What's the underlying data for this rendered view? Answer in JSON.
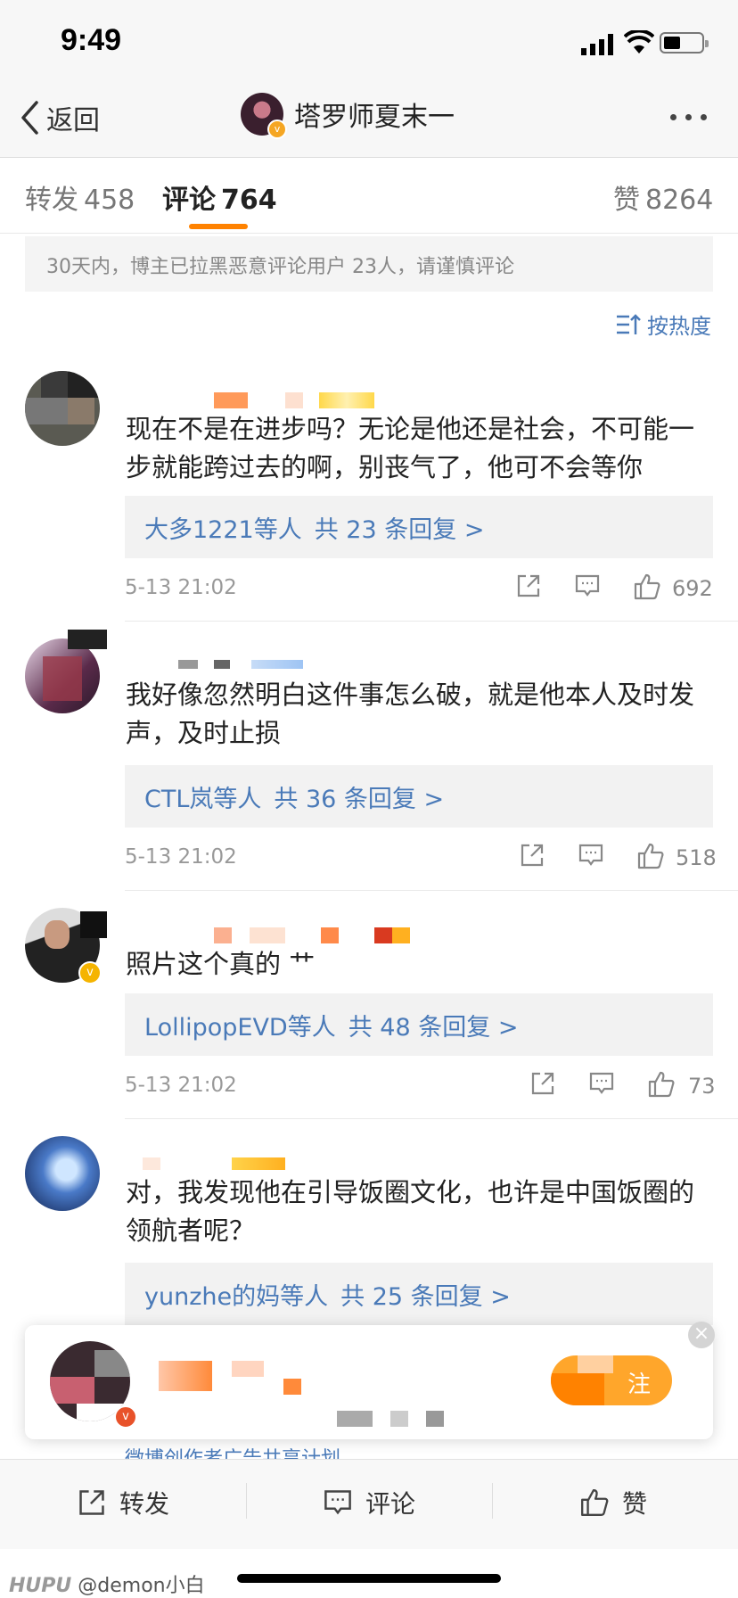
{
  "status_bar": {
    "time": "9:49"
  },
  "nav": {
    "back_label": "返回",
    "title": "塔罗师夏末一"
  },
  "tabs": {
    "repost_label": "转发",
    "repost_count": "458",
    "comment_label": "评论",
    "comment_count": "764",
    "like_label": "赞",
    "like_count": "8264"
  },
  "notice": "30天内，博主已拉黑恶意评论用户 23人，请谨慎评论",
  "sort_label": "按热度",
  "comments": [
    {
      "text": "现在不是在进步吗？无论是他还是社会，不可能一步就能跨过去的啊，别丧气了，他可不会等你",
      "reply_who": "大多1221等人",
      "reply_count": "共 23 条回复 >",
      "date": "5-13 21:02",
      "likes": "692"
    },
    {
      "text": "我好像忽然明白这件事怎么破，就是他本人及时发声，及时止损",
      "reply_who": "CTL岚等人",
      "reply_count": "共 36 条回复 >",
      "date": "5-13 21:02",
      "likes": "518"
    },
    {
      "text": "照片这个真的 艹",
      "reply_who": "LollipopEVD等人",
      "reply_count": "共 48 条回复 >",
      "date": "5-13 21:02",
      "likes": "73"
    },
    {
      "text": "对，我发现他在引导饭圈文化，也许是中国饭圈的领航者呢？",
      "reply_who": "yunzhe的妈等人",
      "reply_count": "共 25 条回复 >"
    }
  ],
  "ad": {
    "button_text": "注",
    "under_text": "微博创作者广告共享计划"
  },
  "bottom_bar": {
    "repost": "转发",
    "comment": "评论",
    "like": "赞"
  },
  "watermark": {
    "brand": "HUPU",
    "user": "@demon小白"
  },
  "colors": {
    "accent": "#ff8200",
    "link": "#4a7ab8",
    "verified": "#f5b400"
  }
}
